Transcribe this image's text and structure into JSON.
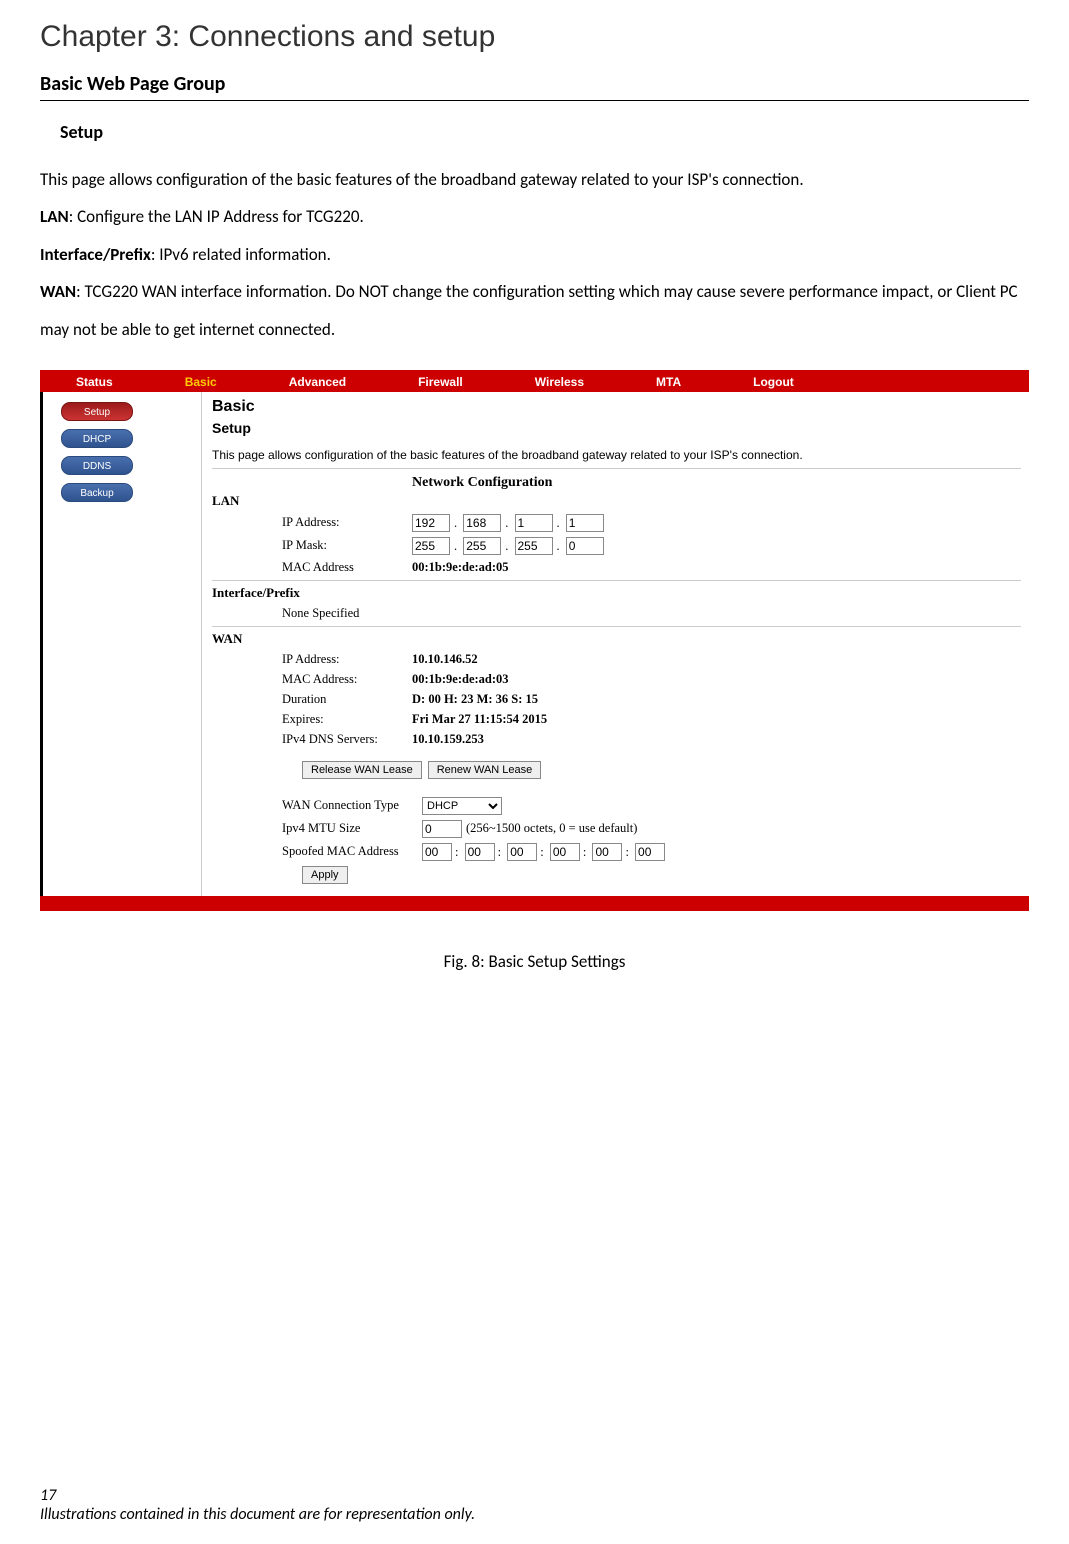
{
  "chapter": {
    "title": "Chapter 3: Connections and setup"
  },
  "section": {
    "h2": "Basic Web Page Group",
    "h3": "Setup",
    "intro": "This page allows configuration of the basic features of the broadband gateway related to your ISP's connection.",
    "lan_bold": "LAN",
    "lan_text": ": Configure the LAN IP Address for TCG220.",
    "ifp_bold": "Interface/Prefix",
    "ifp_text": ": IPv6 related information.",
    "wan_bold": "WAN",
    "wan_text": ": TCG220 WAN interface information. Do NOT change the configuration setting which may cause severe performance impact, or Client PC may not be able to get internet connected."
  },
  "screenshot": {
    "nav": [
      "Status",
      "Basic",
      "Advanced",
      "Firewall",
      "Wireless",
      "MTA",
      "Logout"
    ],
    "nav_active_index": 1,
    "sidebar": [
      {
        "label": "Setup",
        "active": true
      },
      {
        "label": "DHCP",
        "active": false
      },
      {
        "label": "DDNS",
        "active": false
      },
      {
        "label": "Backup",
        "active": false
      }
    ],
    "content": {
      "h1": "Basic",
      "h2": "Setup",
      "sub": "This page allows configuration of the basic features of the broadband gateway related to your ISP's connection.",
      "netconf_title": "Network Configuration",
      "lan": {
        "label": "LAN",
        "ip_label": "IP Address:",
        "ip": [
          "192",
          "168",
          "1",
          "1"
        ],
        "mask_label": "IP Mask:",
        "mask": [
          "255",
          "255",
          "255",
          "0"
        ],
        "mac_label": "MAC Address",
        "mac": "00:1b:9e:de:ad:05"
      },
      "ifp": {
        "label": "Interface/Prefix",
        "none": "None Specified"
      },
      "wan": {
        "label": "WAN",
        "ip_label": "IP Address:",
        "ip": "10.10.146.52",
        "mac_label": "MAC Address:",
        "mac": "00:1b:9e:de:ad:03",
        "dur_label": "Duration",
        "dur": "D: 00 H: 23 M: 36 S: 15",
        "exp_label": "Expires:",
        "exp": "Fri Mar 27 11:15:54 2015",
        "dns_label": "IPv4 DNS Servers:",
        "dns": "10.10.159.253",
        "release_btn": "Release WAN Lease",
        "renew_btn": "Renew WAN Lease",
        "conn_type_label": "WAN Connection Type",
        "conn_type_value": "DHCP",
        "mtu_label": "Ipv4 MTU Size",
        "mtu_value": "0",
        "mtu_hint": "(256~1500 octets, 0 = use default)",
        "spoof_label": "Spoofed MAC Address",
        "spoof": [
          "00",
          "00",
          "00",
          "00",
          "00",
          "00"
        ],
        "apply": "Apply"
      }
    }
  },
  "figure_caption": "Fig. 8: Basic Setup Settings",
  "footer": {
    "page": "17",
    "disclaimer": "Illustrations contained in this document are for representation only."
  }
}
